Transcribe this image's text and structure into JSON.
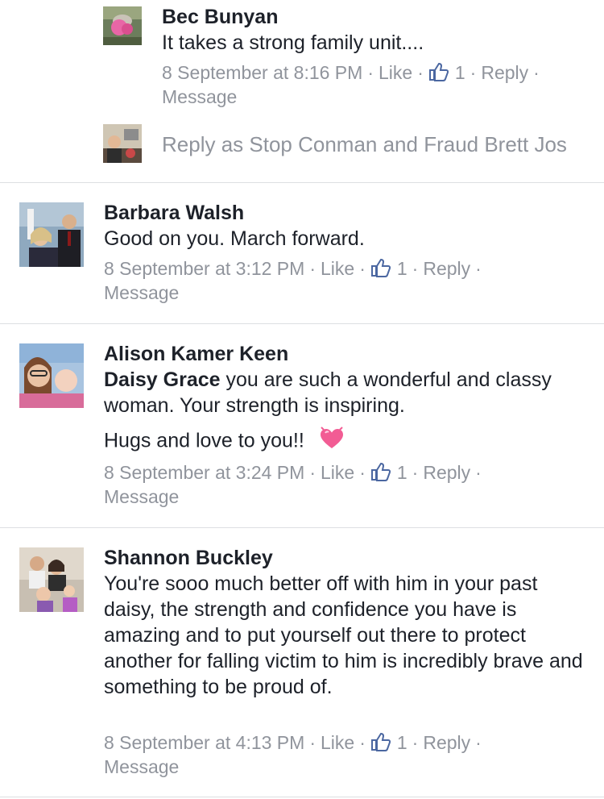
{
  "colors": {
    "meta": "#90949c",
    "text": "#1d2129",
    "divider": "#dddfe2",
    "like_icon": "#4b67a1",
    "heart": "#f25c94"
  },
  "icons": {
    "like": "thumbs-up-icon",
    "heart": "sparkling-heart-emoji"
  },
  "reply_thread": {
    "name": "Bec Bunyan",
    "text": "It takes a strong family unit....",
    "timestamp": "8 September at 8:16 PM",
    "like_label": "Like",
    "like_count": "1",
    "reply_label": "Reply",
    "message_label": "Message"
  },
  "reply_as": {
    "placeholder": "Reply as Stop Conman and Fraud Brett Jos"
  },
  "comments": [
    {
      "name": "Barbara Walsh",
      "text": "Good on you. March forward.",
      "timestamp": "8 September at 3:12 PM",
      "like_label": "Like",
      "like_count": "1",
      "reply_label": "Reply",
      "message_label": "Message"
    },
    {
      "name": "Alison Kamer Keen",
      "mention": "Daisy Grace",
      "text": " you are such a wonderful and classy woman. Your strength is inspiring.",
      "text2": "Hugs and love to you!!",
      "timestamp": "8 September at 3:24 PM",
      "like_label": "Like",
      "like_count": "1",
      "reply_label": "Reply",
      "message_label": "Message"
    },
    {
      "name": "Shannon Buckley",
      "text": "You're sooo much better off with him in your past daisy, the strength and confidence you have is amazing and to put yourself out there to protect another for falling victim to him is incredibly brave and something to be proud of.",
      "timestamp": "8 September at 4:13 PM",
      "like_label": "Like",
      "like_count": "1",
      "reply_label": "Reply",
      "message_label": "Message"
    }
  ]
}
